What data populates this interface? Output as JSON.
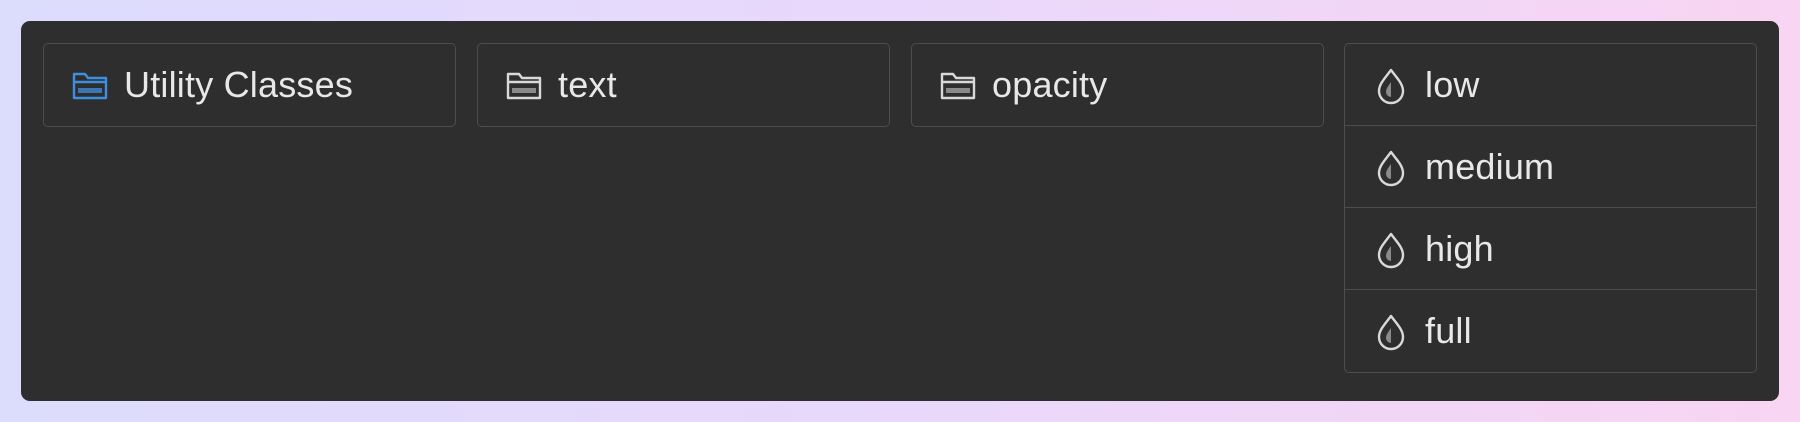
{
  "colors": {
    "panel_bg": "#2e2e2e",
    "border": "#4d4d4d",
    "text": "#e8e8e8",
    "accent_folder": "#3d8fe0",
    "icon_default": "#d9d9d9"
  },
  "columns": [
    {
      "items": [
        {
          "label": "Utility Classes",
          "icon": "folder-icon",
          "active": true
        }
      ]
    },
    {
      "items": [
        {
          "label": "text",
          "icon": "folder-icon"
        }
      ]
    },
    {
      "items": [
        {
          "label": "opacity",
          "icon": "folder-icon"
        }
      ]
    },
    {
      "items": [
        {
          "label": "low",
          "icon": "droplet-half-icon"
        },
        {
          "label": "medium",
          "icon": "droplet-half-icon"
        },
        {
          "label": "high",
          "icon": "droplet-half-icon"
        },
        {
          "label": "full",
          "icon": "droplet-half-icon"
        }
      ]
    }
  ]
}
